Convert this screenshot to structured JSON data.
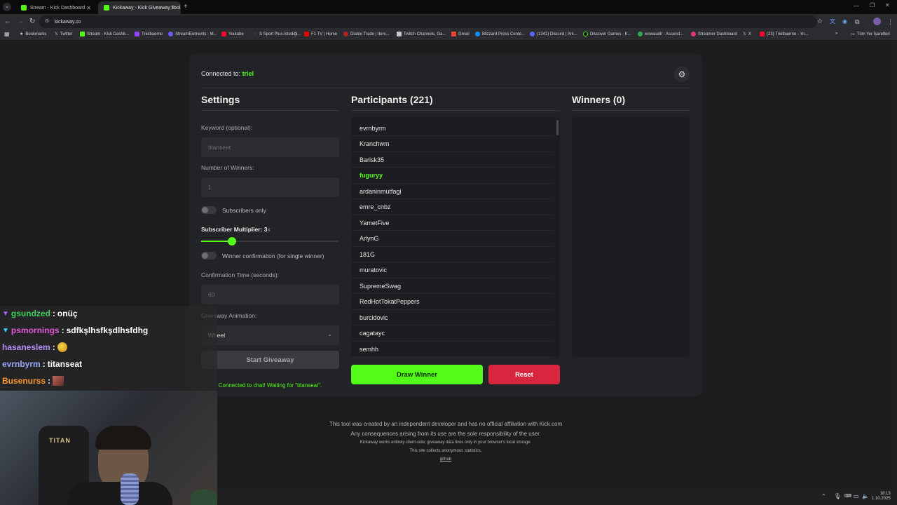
{
  "browser": {
    "tabs": [
      {
        "label": "Stream - Kick Dashboard",
        "active": false
      },
      {
        "label": "Kickaway - Kick Giveaway Tool",
        "active": true
      }
    ],
    "new_tab": "+",
    "url": "kickaway.co",
    "bookmarks": [
      "Bookmarks",
      "Twitter",
      "Stream - Kick Dashb...",
      "Trielbaerne",
      "StreamElements - M...",
      "Youtube",
      "S Sport Plus-İstediği...",
      "F1 TV | Home",
      "Diablo Trade | Item...",
      "Twitch Channels, Ga...",
      "Gmail",
      "Blizzard Press Cente...",
      "(1342) Discord | Ark...",
      "Discover Games - K...",
      "wowaudit - Ascend...",
      "Streamer Dashboard",
      "X",
      "(23) Trielbaerne - Yo..."
    ],
    "all_bookmarks": "Tüm Yer İşaretleri",
    "overflow": "»"
  },
  "app": {
    "connected_prefix": "Connected to:",
    "connected_channel": "triel",
    "settings": {
      "title": "Settings",
      "keyword_label": "Keyword (optional):",
      "keyword_value": "titanseat",
      "winners_label": "Number of Winners:",
      "winners_value": "1",
      "subscribers_only": "Subscribers only",
      "multiplier_label": "Subscriber Multiplier: 3",
      "multiplier_suffix": "x",
      "multiplier_value": 3,
      "winner_confirmation": "Winner confirmation (for single winner)",
      "confirm_time_label": "Confirmation Time (seconds):",
      "confirm_time_value": "60",
      "animation_label": "Giveaway Animation:",
      "animation_value": "Wheel",
      "start_button": "Start Giveaway",
      "status": "Connected to chat! Waiting for \"titanseat\"."
    },
    "participants": {
      "title": "Participants (221)",
      "items": [
        "evrnbyrm",
        "Kranchwm",
        "Barisk35",
        "fuguryy",
        "ardaninmutfagi",
        "emre_cnbz",
        "YametFive",
        "ArlynG",
        "181G",
        "muratovic",
        "SupremeSwag",
        "RedHotTokatPeppers",
        "burcidovic",
        "cagatayc",
        "semhh"
      ],
      "highlighted": "fuguryy"
    },
    "winners": {
      "title": "Winners (0)"
    },
    "draw_button": "Draw Winner",
    "reset_button": "Reset",
    "colors": {
      "accent": "#53fc18",
      "reset": "#d7263d",
      "card": "#222326",
      "background": "#1b1c1e"
    }
  },
  "footer": {
    "line1": "This tool was created by an independent developer and has no official affiliation with Kick.com",
    "line2": "Any consequences arising from its use are the sole responsibility of the user.",
    "line3": "Kickaway works entirely client-side; giveaway data lives only in your browser's local storage.",
    "line4": "This site collects anonymous statistics.",
    "link": "github"
  },
  "chat": [
    {
      "user": "gsundzed",
      "message": "onüç",
      "color": "#3ecf5a",
      "badge": "gem"
    },
    {
      "user": "psmornings",
      "message": "sdfkşlhsfkşdlhsfdhg",
      "color": "#e05ad4",
      "badge": "gem"
    },
    {
      "user": "hasaneslem",
      "message": "",
      "color": "#b48ef5",
      "emote": true
    },
    {
      "user": "evrnbyrm",
      "message": "titanseat",
      "color": "#9aa8ff"
    },
    {
      "user": "Busenurss",
      "message": "",
      "color": "#ff9a2e",
      "emote": true
    }
  ],
  "webcam": {
    "chair_brand": "TITAN"
  },
  "taskbar": {
    "time": "18:13",
    "date": "1.10.2025"
  }
}
